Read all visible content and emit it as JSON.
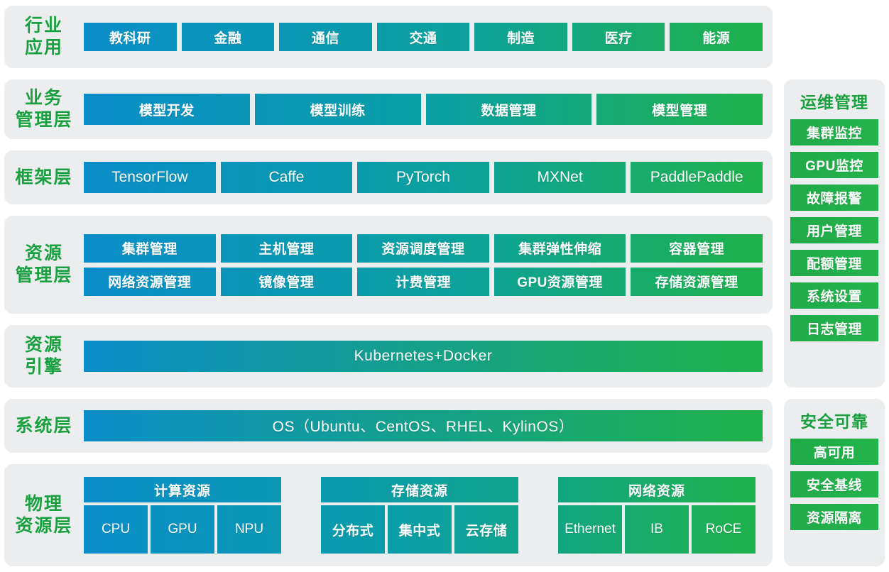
{
  "theme": {
    "panel_bg": "#ebedee",
    "label_color": "#1aa040",
    "gradient_start": "#0b8ec9",
    "gradient_mid": "#0a9fa5",
    "gradient_end": "#1fb24a",
    "text_color": "#ffffff"
  },
  "layers": [
    {
      "label_lines": [
        "行业",
        "应用"
      ],
      "name": "industry-application-layer",
      "rows": [
        [
          "教科研",
          "金融",
          "通信",
          "交通",
          "制造",
          "医疗",
          "能源"
        ]
      ]
    },
    {
      "label_lines": [
        "业务",
        "管理层"
      ],
      "name": "business-management-layer",
      "rows": [
        [
          "模型开发",
          "模型训练",
          "数据管理",
          "模型管理"
        ]
      ]
    },
    {
      "label_lines": [
        "框架层"
      ],
      "name": "framework-layer",
      "rows": [
        [
          "TensorFlow",
          "Caffe",
          "PyTorch",
          "MXNet",
          "PaddlePaddle"
        ]
      ]
    },
    {
      "label_lines": [
        "资源",
        "管理层"
      ],
      "name": "resource-management-layer",
      "rows": [
        [
          "集群管理",
          "主机管理",
          "资源调度管理",
          "集群弹性伸缩",
          "容器管理"
        ],
        [
          "网络资源管理",
          "镜像管理",
          "计费管理",
          "GPU资源管理",
          "存储资源管理"
        ]
      ]
    },
    {
      "label_lines": [
        "资源",
        "引擎"
      ],
      "name": "resource-engine-layer",
      "rows": [
        [
          "Kubernetes+Docker"
        ]
      ]
    },
    {
      "label_lines": [
        "系统层"
      ],
      "name": "system-layer",
      "rows": [
        [
          "OS（Ubuntu、CentOS、RHEL、KylinOS）"
        ]
      ]
    }
  ],
  "physical_layer": {
    "label_lines": [
      "物理",
      "资源层"
    ],
    "name": "physical-resource-layer",
    "groups": [
      {
        "title": "计算资源",
        "items": [
          "CPU",
          "GPU",
          "NPU"
        ],
        "latin": true
      },
      {
        "title": "存储资源",
        "items": [
          "分布式",
          "集中式",
          "云存储"
        ],
        "latin": false
      },
      {
        "title": "网络资源",
        "items": [
          "Ethernet",
          "IB",
          "RoCE"
        ],
        "latin": true
      }
    ]
  },
  "side_panels": [
    {
      "title": "运维管理",
      "name": "ops-management-panel",
      "items": [
        "集群监控",
        "GPU监控",
        "故障报警",
        "用户管理",
        "配额管理",
        "系统设置",
        "日志管理"
      ]
    },
    {
      "title": "安全可靠",
      "name": "security-reliability-panel",
      "items": [
        "高可用",
        "安全基线",
        "资源隔离"
      ]
    }
  ]
}
